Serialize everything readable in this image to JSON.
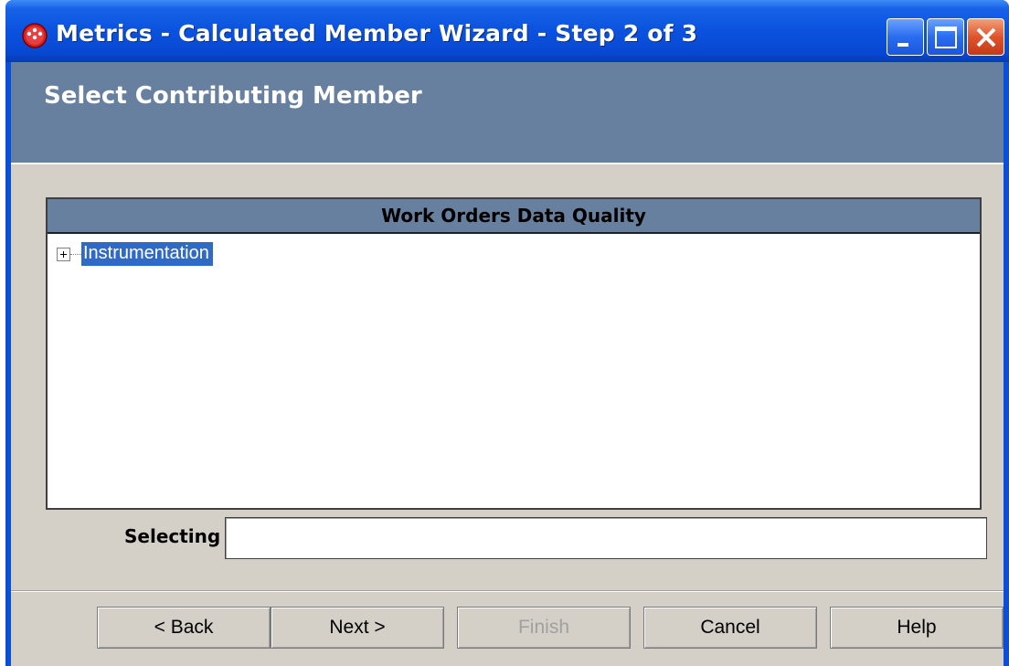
{
  "window": {
    "title": "Metrics - Calculated Member Wizard - Step 2 of 3",
    "app_icon": "red-circle-app-icon",
    "controls": [
      "minimize-icon",
      "maximize-icon",
      "close-icon"
    ]
  },
  "header": {
    "title": "Select Contributing Member"
  },
  "tree": {
    "title": "Work Orders Data Quality",
    "nodes": [
      {
        "label": "Instrumentation",
        "expanded": false,
        "selected": true
      }
    ]
  },
  "selecting": {
    "label": "Selecting",
    "value": ""
  },
  "buttons": {
    "back": "< Back",
    "next": "Next >",
    "finish": "Finish",
    "cancel": "Cancel",
    "help": "Help"
  },
  "colors": {
    "titlebar": "#0a52de",
    "header_band": "#6880a0",
    "selection": "#316ac5",
    "dialog_bg": "#d4d0c8"
  }
}
